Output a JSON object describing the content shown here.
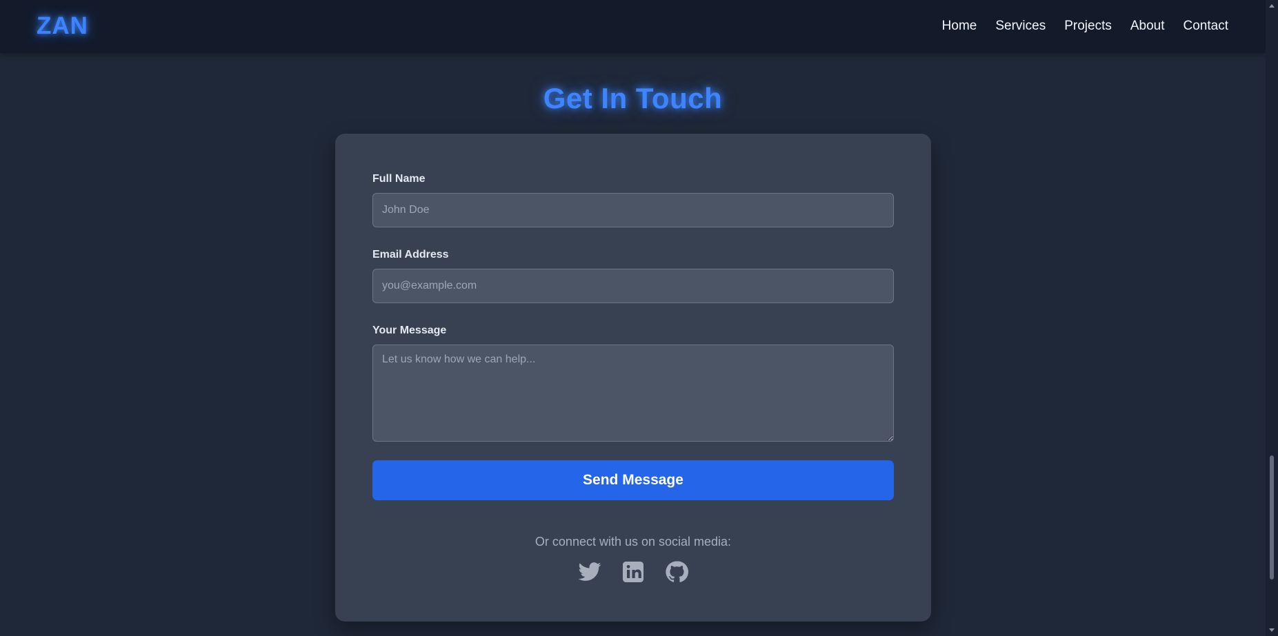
{
  "brand": {
    "logo": "ZAN"
  },
  "nav": {
    "items": [
      "Home",
      "Services",
      "Projects",
      "About",
      "Contact"
    ]
  },
  "page": {
    "title": "Get In Touch"
  },
  "form": {
    "full_name_label": "Full Name",
    "full_name_placeholder": "John Doe",
    "email_label": "Email Address",
    "email_placeholder": "you@example.com",
    "message_label": "Your Message",
    "message_placeholder": "Let us know how we can help...",
    "submit_label": "Send Message"
  },
  "social": {
    "prompt": "Or connect with us on social media:",
    "icons": [
      "twitter-icon",
      "linkedin-icon",
      "github-icon"
    ]
  },
  "colors": {
    "accent_blue": "#3d82ff",
    "button_blue": "#2565e9",
    "background": "#1f2838",
    "card": "#374152",
    "header": "#131b2b",
    "icon_gray": "#a7afbd"
  }
}
